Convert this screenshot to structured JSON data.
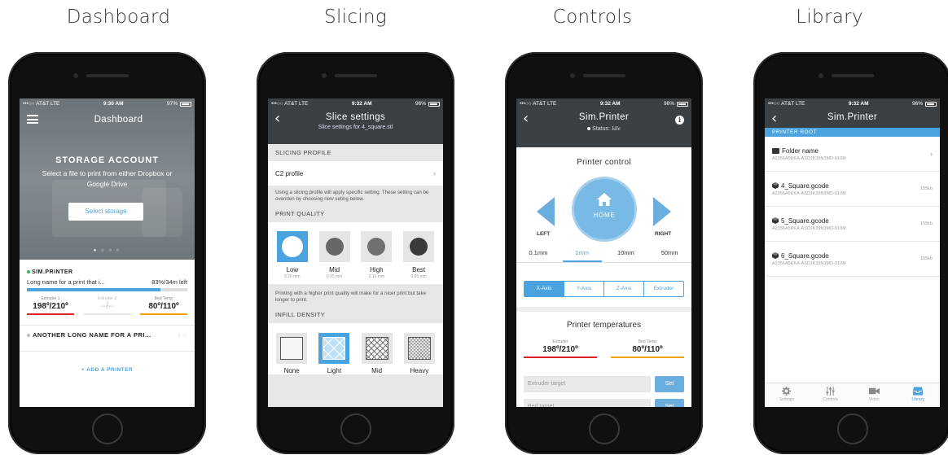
{
  "captions": [
    "Dashboard",
    "Slicing",
    "Controls",
    "Library"
  ],
  "statusbar": {
    "dashboard": {
      "carrier": "•••○○ AT&T  LTE",
      "time": "9:30 AM",
      "battery": "97%"
    },
    "slicing": {
      "carrier": "•••○○ AT&T  LTE",
      "time": "9:32 AM",
      "battery": "96%"
    },
    "controls": {
      "carrier": "•••○○ AT&T  LTE",
      "time": "9:32 AM",
      "battery": "96%"
    },
    "library": {
      "carrier": "•••○○ AT&T  LTE",
      "time": "9:32 AM",
      "battery": "96%"
    }
  },
  "dashboard": {
    "title": "Dashboard",
    "storage_title": "STORAGE ACCOUNT",
    "storage_desc": "Select a file to print from either Dropbox or Google Drive",
    "storage_button": "Select storage",
    "printer1": {
      "name": "SIM.PRINTER",
      "job": "Long name for a print that i...",
      "progress_text": "83%/34m left",
      "progress": 0.83,
      "temps": [
        {
          "label": "Extruder 1",
          "value": "198º/210º"
        },
        {
          "label": "Extruder 2",
          "value": "--/--"
        },
        {
          "label": "Bed Temp",
          "value": "80º/110º"
        }
      ]
    },
    "printer2": {
      "name": "ANOTHER LONG NAME FOR A PRI..."
    },
    "add_printer": "+ ADD A PRINTER"
  },
  "slicing": {
    "title": "Slice settings",
    "subtitle": "Slice settings for 4_square.stl",
    "profile_header": "SLICING PROFILE",
    "profile_value": "C2 profile",
    "profile_note": "Using a slicing profile will apply specific setting. These setting can be overiden by choosing new seting below.",
    "quality_header": "PRINT QUALITY",
    "quality": [
      {
        "label": "Low",
        "sub": "0.20 mm"
      },
      {
        "label": "Mid",
        "sub": "0.15 mm"
      },
      {
        "label": "High",
        "sub": "0.10 mm"
      },
      {
        "label": "Best",
        "sub": "0.05 mm"
      }
    ],
    "quality_note": "Printing with a higher print quality will make for a nicer print but take longer to print.",
    "infill_header": "INFILL DENSITY",
    "infill": [
      "None",
      "Light",
      "Mid",
      "Heavy"
    ]
  },
  "controls": {
    "title": "Sim.Printer",
    "status_label": "Status:",
    "status_value": "Idle",
    "printer_control": "Printer control",
    "home": "HOME",
    "left": "LEFT",
    "right": "RIGHT",
    "steps": [
      "0.1mm",
      "1mm",
      "10mm",
      "50mm"
    ],
    "axes": [
      "X-Axis",
      "Y-Axis",
      "Z-Axis",
      "Extruder"
    ],
    "temps_title": "Printer temperatures",
    "temps": [
      {
        "label": "Extruder",
        "value": "198º/210º"
      },
      {
        "label": "Bed Temp",
        "value": "80º/110º"
      }
    ],
    "extruder_target": "Extruder target",
    "bed_target": "Bed target",
    "set": "Set"
  },
  "library": {
    "title": "Sim.Printer",
    "root": "PRINTER ROOT",
    "items": [
      {
        "name": "Folder name",
        "hash": "A2356A5KKA-ASDJK39N3MD-010M",
        "size": "",
        "type": "folder"
      },
      {
        "name": "4_Square.gcode",
        "hash": "A2356A5KKA-ASDJK39N3MD-010M",
        "size": "155kb",
        "type": "file"
      },
      {
        "name": "5_Square.gcode",
        "hash": "A2356A5KKA-ASDJK39N3MD-010M",
        "size": "155kb",
        "type": "file"
      },
      {
        "name": "6_Square.gcode",
        "hash": "A2356A5KKA-ASDJK39N3MD-010M",
        "size": "155kb",
        "type": "file"
      }
    ],
    "tabs": [
      "Settings",
      "Controls",
      "Video",
      "Library"
    ]
  }
}
